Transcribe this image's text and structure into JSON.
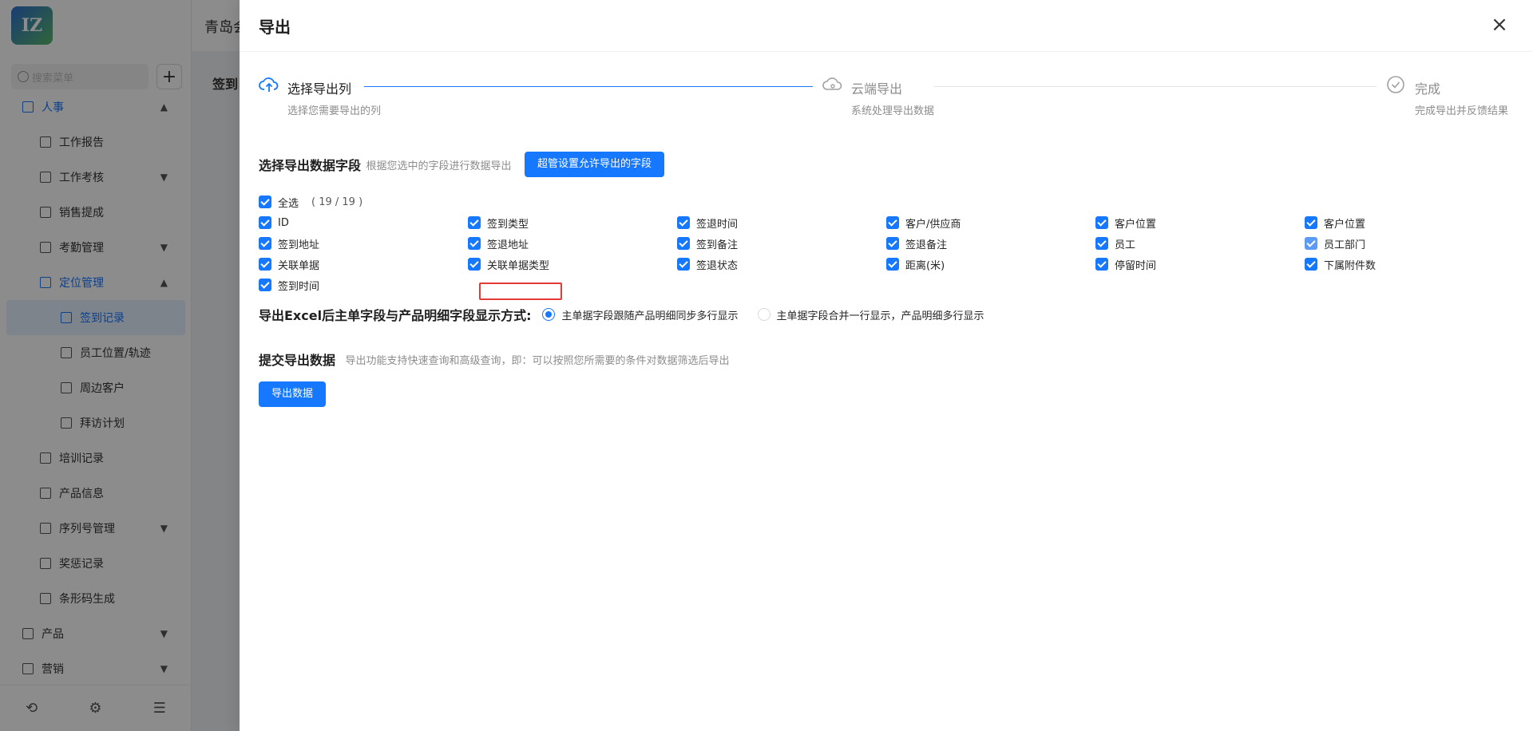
{
  "app": {
    "logo_text": "IZ",
    "company_name": "青岛会",
    "search_placeholder": "搜索菜单",
    "bg_title": "签到"
  },
  "sidebar": {
    "items": [
      {
        "label": "人事",
        "level": 0,
        "state": "expanded-active",
        "chevron": "up"
      },
      {
        "label": "工作报告",
        "level": 1
      },
      {
        "label": "工作考核",
        "level": 1,
        "chevron": "down"
      },
      {
        "label": "销售提成",
        "level": 1
      },
      {
        "label": "考勤管理",
        "level": 1,
        "chevron": "down"
      },
      {
        "label": "定位管理",
        "level": 1,
        "state": "expanded-active",
        "chevron": "up"
      },
      {
        "label": "签到记录",
        "level": 2,
        "state": "selected"
      },
      {
        "label": "员工位置/轨迹",
        "level": 2
      },
      {
        "label": "周边客户",
        "level": 2
      },
      {
        "label": "拜访计划",
        "level": 2
      },
      {
        "label": "培训记录",
        "level": 1
      },
      {
        "label": "产品信息",
        "level": 1
      },
      {
        "label": "序列号管理",
        "level": 1,
        "chevron": "down"
      },
      {
        "label": "奖惩记录",
        "level": 1
      },
      {
        "label": "条形码生成",
        "level": 1
      },
      {
        "label": "产品",
        "level": 0,
        "chevron": "down"
      },
      {
        "label": "营销",
        "level": 0,
        "chevron": "down"
      }
    ]
  },
  "drawer": {
    "title": "导出",
    "close_icon": "×"
  },
  "steps": [
    {
      "title": "选择导出列",
      "desc": "选择您需要导出的列",
      "icon": "cloud-upload-icon",
      "status": "active"
    },
    {
      "title": "云端导出",
      "desc": "系统处理导出数据",
      "icon": "cloud-icon",
      "status": "wait"
    },
    {
      "title": "完成",
      "desc": "完成导出并反馈结果",
      "icon": "check-circle-icon",
      "status": "wait"
    }
  ],
  "fields_section": {
    "title": "选择导出数据字段",
    "hint": "根据您选中的字段进行数据导出",
    "button": "超管设置允许导出的字段",
    "select_all": "全选",
    "count": "( 19 / 19 )",
    "fields": [
      "ID",
      "签到类型",
      "签退时间",
      "客户/供应商",
      "客户位置",
      "客户位置",
      "签到地址",
      "签退地址",
      "签到备注",
      "签退备注",
      "员工",
      "员工部门",
      "关联单据",
      "关联单据类型",
      "签退状态",
      "距离(米)",
      "停留时间",
      "下属附件数",
      "签到时间"
    ]
  },
  "display_section": {
    "title": "导出Excel后主单字段与产品明细字段显示方式:",
    "options": [
      {
        "label": "主单据字段跟随产品明细同步多行显示",
        "selected": true
      },
      {
        "label": "主单据字段合并一行显示，产品明细多行显示",
        "selected": false
      }
    ]
  },
  "submit_section": {
    "title": "提交导出数据",
    "hint": "导出功能支持快速查询和高级查询，即：可以按照您所需要的条件对数据筛选后导出",
    "button": "导出数据"
  },
  "colors": {
    "primary": "#1677ff",
    "overlay": "rgba(0,0,0,0.45)",
    "highlight_box": "#e53935"
  }
}
